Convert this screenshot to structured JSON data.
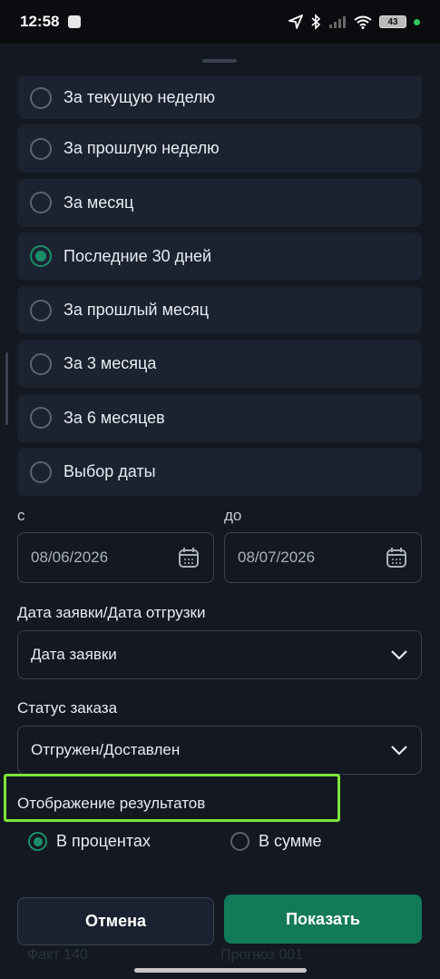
{
  "status_bar": {
    "time": "12:58",
    "battery": "43",
    "icons": [
      "location-arrow-icon",
      "bluetooth-icon",
      "signal-icon",
      "wifi-icon",
      "battery-icon"
    ]
  },
  "period_options": [
    {
      "label": "За текущую  неделю",
      "checked": false
    },
    {
      "label": "За прошлую неделю",
      "checked": false
    },
    {
      "label": "За месяц",
      "checked": false
    },
    {
      "label": "Последние 30 дней",
      "checked": true
    },
    {
      "label": "За прошлый месяц",
      "checked": false
    },
    {
      "label": "За 3 месяца",
      "checked": false
    },
    {
      "label": "За 6 месяцев",
      "checked": false
    },
    {
      "label": "Выбор даты",
      "checked": false
    }
  ],
  "date_range": {
    "from_label": "с",
    "to_label": "до",
    "from_value": "08/06/2026",
    "to_value": "08/07/2026"
  },
  "date_type": {
    "label": "Дата заявки/Дата отгрузки",
    "value": "Дата заявки"
  },
  "order_status": {
    "label": "Статус заказа",
    "value": "Отгружен/Доставлен"
  },
  "results_display": {
    "label": "Отображение результатов",
    "options": [
      {
        "label": "В процентах",
        "checked": true
      },
      {
        "label": "В сумме",
        "checked": false
      }
    ]
  },
  "actions": {
    "cancel": "Отмена",
    "show": "Показать"
  },
  "background_text": {
    "left": "Факт 140",
    "right": "Прогноз 001"
  },
  "colors": {
    "accent": "#137a59",
    "highlight": "#7ee53b",
    "sheet": "#131821"
  }
}
